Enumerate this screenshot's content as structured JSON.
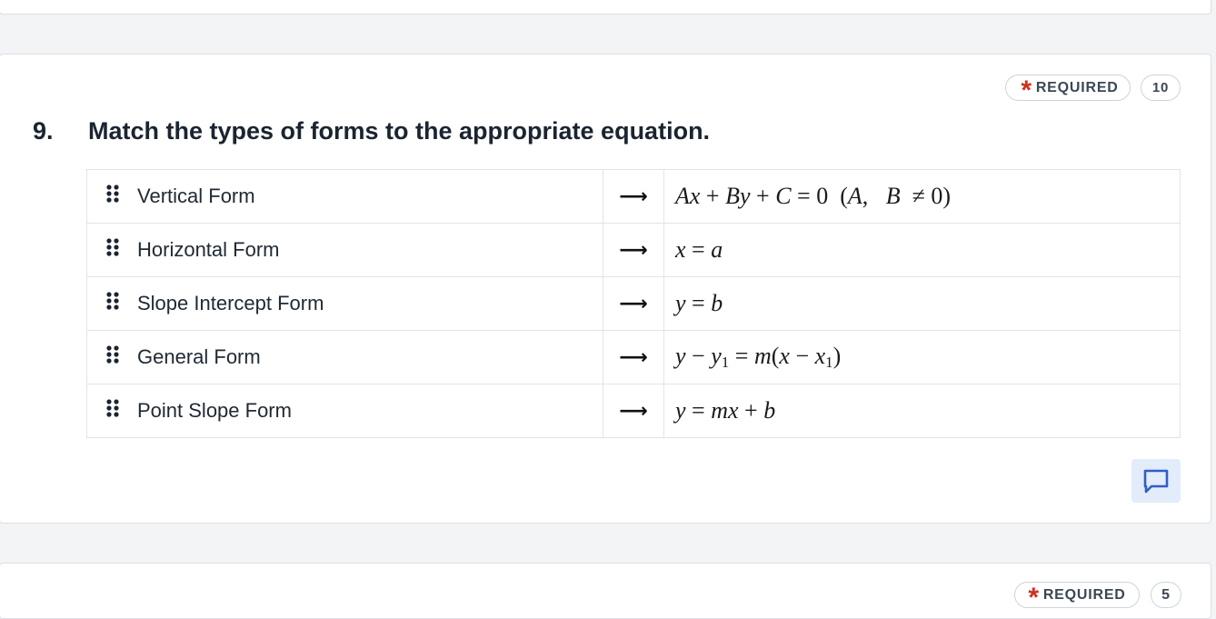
{
  "question": {
    "number": "9.",
    "text": "Match the types of forms to the appropriate equation.",
    "required_label": "REQUIRED",
    "points": "10"
  },
  "pairs": [
    {
      "left": "Vertical Form",
      "arrow": "⟶",
      "right": "Ax + By + C = 0 (A, B ≠ 0)"
    },
    {
      "left": "Horizontal Form",
      "arrow": "⟶",
      "right": "x = a"
    },
    {
      "left": "Slope Intercept Form",
      "arrow": "⟶",
      "right": "y = b"
    },
    {
      "left": "General Form",
      "arrow": "⟶",
      "right": "y − y1 = m(x − x1)"
    },
    {
      "left": "Point Slope Form",
      "arrow": "⟶",
      "right": "y = mx + b"
    }
  ],
  "next_question": {
    "required_label": "REQUIRED",
    "points": "5"
  },
  "icons": {
    "drag": "drag-handle-icon",
    "comment": "comment-icon",
    "required": "asterisk-icon"
  },
  "colors": {
    "required_star": "#d12f1f",
    "comment_bg": "#e2ecfb",
    "comment_icon": "#2f5fc4"
  }
}
